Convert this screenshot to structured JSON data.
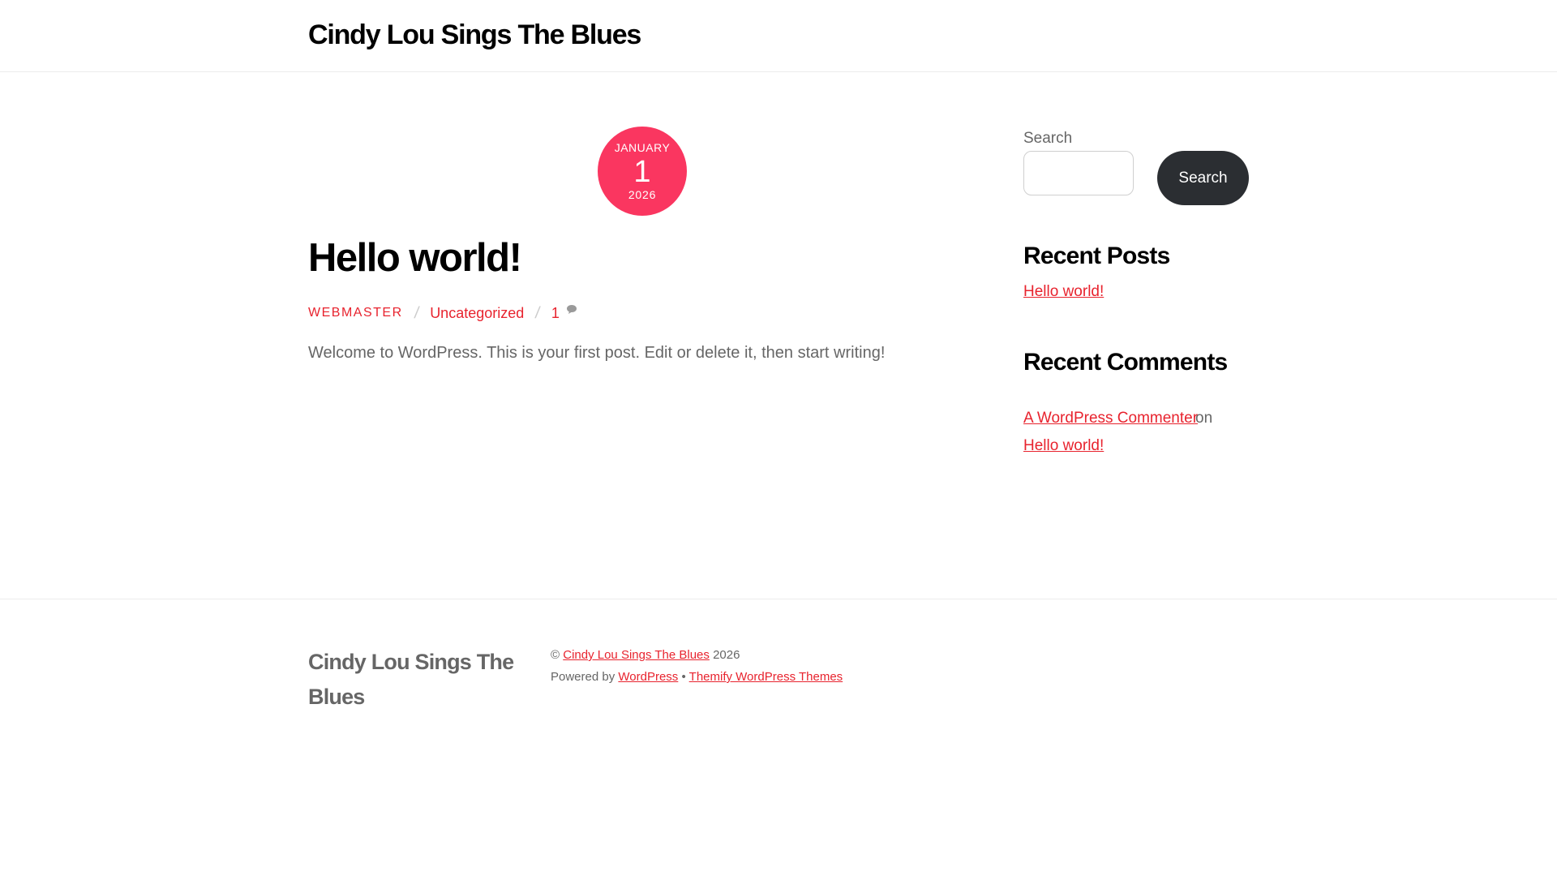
{
  "header": {
    "site_title": "Cindy Lou Sings The Blues"
  },
  "post": {
    "date": {
      "month": "JANUARY",
      "day": "1",
      "year": "2026"
    },
    "title": "Hello world!",
    "meta": {
      "author": "WEBMASTER",
      "separator": "/",
      "category": "Uncategorized",
      "comment_count": "1"
    },
    "excerpt": "Welcome to WordPress. This is your first post. Edit or delete it, then start writing!"
  },
  "sidebar": {
    "search": {
      "label": "Search",
      "value": "",
      "button_label": "Search"
    },
    "recent_posts": {
      "title": "Recent Posts",
      "items": [
        "Hello world!"
      ]
    },
    "recent_comments": {
      "title": "Recent Comments",
      "commenter": "A WordPress Commenter",
      "connector": "on",
      "post": "Hello world!"
    }
  },
  "footer": {
    "site_title": "Cindy Lou Sings The Blues",
    "copyright_symbol": "©",
    "copyright_link": "Cindy Lou Sings The Blues",
    "copyright_year": "2026",
    "powered_by": "Powered by",
    "wordpress_link": "WordPress",
    "bullet": "•",
    "themify_link": "Themify WordPress Themes"
  },
  "icons": {
    "comment": "comment-bubble-icon"
  },
  "colors": {
    "accent": "#e8232e",
    "date_badge": "#fa3660",
    "button": "#2b2e32"
  }
}
